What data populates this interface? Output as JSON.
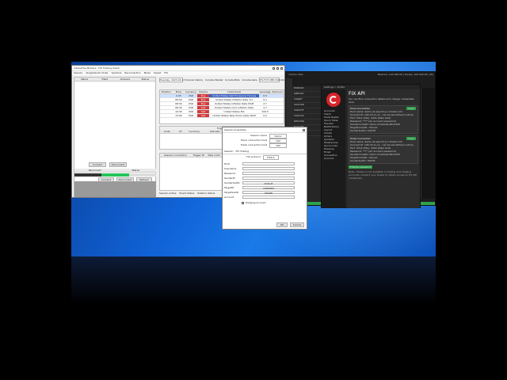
{
  "trade_window": {
    "title": "Interactive Brokers - FIX Trading Client",
    "menu": [
      "Session",
      "Single/Quick Order",
      "Symbols",
      "Reconnection",
      "Mode",
      "Speed",
      "FIX"
    ],
    "left_columns": [
      "Name",
      "Filled",
      "Ordered",
      "Status"
    ],
    "lower_columns": [
      "Reconnect",
      "Status"
    ],
    "lower_buttons": [
      "Connect",
      "Disconnect"
    ],
    "lower_tabs": [
      "Connect",
      "Disconnect",
      "Refresh"
    ],
    "top_controls": {
      "date": "Tuesday, 2023-01-17",
      "checks": [
        "Include history",
        "Include Market",
        "Include Bids",
        "Include Asks"
      ]
    },
    "symbol_filter": "ES.FUT.CME.USD.202303",
    "grid_columns": [
      "Position",
      "Price",
      "Currency",
      "Volume",
      "Instrument",
      "Leverage",
      "Premium"
    ],
    "grid_rows": [
      {
        "pos": "",
        "price": "0.05",
        "cur": "USD",
        "vol": "Buy",
        "inst": "United States S&P Emissions Futures",
        "lev": "0.5",
        "prem": "",
        "vcolor": "red",
        "selected": true
      },
      {
        "pos": "",
        "price": "08:30",
        "cur": "USD",
        "vol": "Buy",
        "inst": "United States Inflation Rate YoY",
        "lev": "0.1",
        "prem": "",
        "vcolor": "red",
        "selected": false
      },
      {
        "pos": "",
        "price": "08:30",
        "cur": "USD",
        "vol": "Buy",
        "inst": "United States Inflation Rate MoM",
        "lev": "2.7",
        "prem": "",
        "vcolor": "red",
        "selected": false
      },
      {
        "pos": "",
        "price": "08:30",
        "cur": "USD",
        "vol": "Sell",
        "inst": "United States Core Inflation Rate",
        "lev": "2.7",
        "prem": "",
        "vcolor": "red",
        "selected": false
      },
      {
        "pos": "",
        "price": "10:30",
        "cur": "USD",
        "vol": "Sell",
        "inst": "United States EIA",
        "lev": "100.5",
        "prem": "",
        "vcolor": "red",
        "selected": false
      },
      {
        "pos": "",
        "price": "13:00",
        "cur": "USD",
        "vol": "Sell",
        "inst": "United States New Home Sales MoM",
        "lev": "0.2",
        "prem": "",
        "vcolor": "red",
        "selected": false
      }
    ],
    "triggers_title": "Triggers",
    "trigger_columns": [
      "Code",
      "ID",
      "Currency",
      "Indicator",
      "Forecast",
      "Triggered",
      "Sym",
      "Strategy"
    ],
    "session_columns": [
      "Session connection",
      "Trigger ID",
      "New order"
    ],
    "status_items": [
      "Session active",
      "Event status",
      "Position status"
    ]
  },
  "order_dialog": {
    "title": "Session properties",
    "fields": [
      {
        "label": "Session name",
        "value": "Demo"
      },
      {
        "label": "Place connection host",
        "value": "192"
      },
      {
        "label": "Trade connection host",
        "value": "192"
      }
    ],
    "tabs": [
      "Session",
      "FIX Trading"
    ],
    "fix_protocol_label": "FIX protocol",
    "fix_protocol_value": "FIX4.4",
    "form": [
      {
        "label": "Host",
        "value": ""
      },
      {
        "label": "Username",
        "value": ""
      },
      {
        "label": "Password",
        "value": ""
      },
      {
        "label": "SenderID",
        "value": ""
      },
      {
        "label": "SenderSubID",
        "value": "Default"
      },
      {
        "label": "TargetID",
        "value": "CSERVER"
      },
      {
        "label": "TargetSubID",
        "value": "TRADE"
      },
      {
        "label": "Account",
        "value": ""
      }
    ],
    "hedging_label": "Hedging account",
    "port_label": "Port",
    "ok": "OK",
    "cancel": "Cancel"
  },
  "ctrader": {
    "title": "cTrader Web",
    "symbols": [
      "EURUSD",
      "GBPUSD",
      "USDJPY",
      "AUDUSD",
      "USDCHF",
      "USDCAD",
      "NZDUSD",
      "EURGBP",
      "EURJPY"
    ],
    "nav": [
      "Trade",
      "Copy",
      "Analyze"
    ],
    "balance_line": "Balance: 100 000.00 | Equity: 100 000.00 | Margin 0.00 | Free Margin: 100 000.00"
  },
  "settings": {
    "window_title": "Settings > Profile",
    "heading": "FIX API",
    "menu": [
      "Accounts",
      "Client",
      "Trade Rights",
      "Quick Trade",
      "Transfer",
      "Notifications",
      "Layout",
      "Charts",
      "Orders",
      "Symbols",
      "Preferences",
      "Quick Links",
      "Drawing",
      "Email",
      "Connection",
      "Account"
    ],
    "intro": "You can find connection details and change credentials here",
    "price_section": "Price Connection",
    "price_lines": [
      "Host name: demo-uk-eqx-01.p.c-trader.com",
      "(Current IP: 195.74.xx.xx - can be set without notice)",
      "Port: 5211 (SSL), 5201 (Plain text)",
      "Password: **** (a/c account password)",
      "SenderCompID: demo.icmarkets.8012345",
      "TargetCompID: cServer",
      "SenderSubID: QUOTE"
    ],
    "trade_section": "Trade Connection",
    "trade_lines": [
      "Host name: demo-uk-eqx-01.p.c-trader.com",
      "(Current IP: 195.74.xx.xx - can be set without notice)",
      "Port: 5212 (SSL), 5202 (Plain text)",
      "Password: **** (a/c account password)",
      "SenderCompID: demo.icmarkets.8012345",
      "TargetCompID: cServer",
      "SenderSubID: TRADE"
    ],
    "copy_button": "Copy",
    "change_password": "Change password",
    "note": "Note: cTrader is not available in trading and hedging accounts. Contact your broker to obtain access to FIX API credentials."
  }
}
